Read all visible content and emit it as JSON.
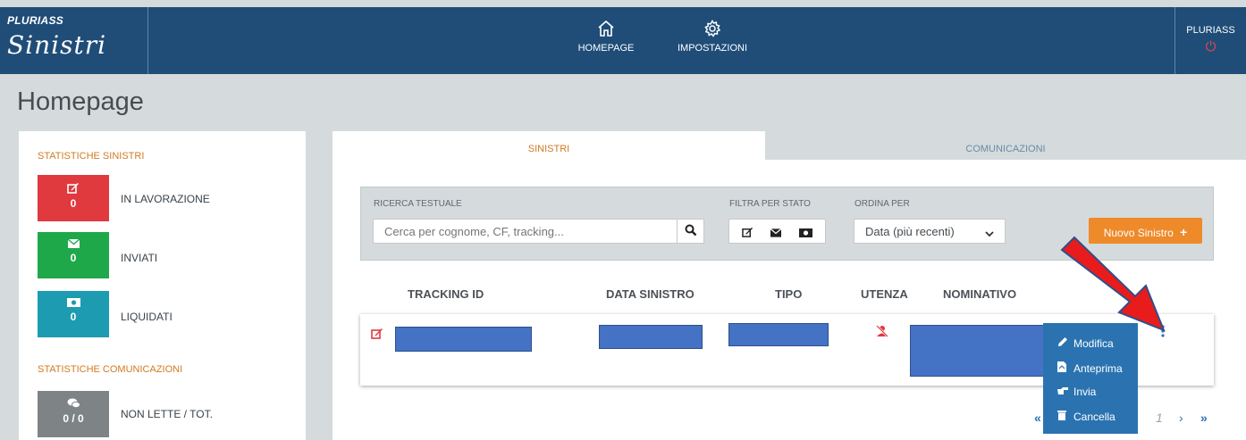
{
  "app": {
    "brand_small": "PLURIASS",
    "brand_main": "Sinistri",
    "user_name": "PLURIASS"
  },
  "nav": {
    "home_label": "HOMEPAGE",
    "settings_label": "IMPOSTAZIONI"
  },
  "page_title": "Homepage",
  "stats": {
    "claims_title": "STATISTICHE SINISTRI",
    "in_progress_label": "IN LAVORAZIONE",
    "in_progress_value": "0",
    "sent_label": "INVIATI",
    "sent_value": "0",
    "settled_label": "LIQUIDATI",
    "settled_value": "0",
    "comms_title": "STATISTICHE COMUNICAZIONI",
    "unread_label": "NON LETTE / TOT.",
    "unread_value": "0 / 0",
    "colors": {
      "in_progress": "#e0393e",
      "sent": "#1fa84a",
      "settled": "#1d9bb0",
      "unread": "#7e8386"
    }
  },
  "tabs": {
    "claims": "SINISTRI",
    "communications": "COMUNICAZIONI"
  },
  "filters": {
    "search_label": "RICERCA TESTUALE",
    "search_placeholder": "Cerca per cognome, CF, tracking...",
    "state_label": "FILTRA PER STATO",
    "sort_label": "ORDINA PER",
    "sort_value": "Data (più recenti)",
    "new_button": "Nuovo Sinistro"
  },
  "table": {
    "headers": [
      "TRACKING ID",
      "DATA SINISTRO",
      "TIPO",
      "UTENZA",
      "NOMINATIVO"
    ]
  },
  "menu": {
    "edit": "Modifica",
    "preview": "Anteprima",
    "send": "Invia",
    "delete": "Cancella"
  },
  "pagination": {
    "current_page": "1"
  },
  "accent": "#ee8a2a",
  "header_color": "#1f4d78"
}
